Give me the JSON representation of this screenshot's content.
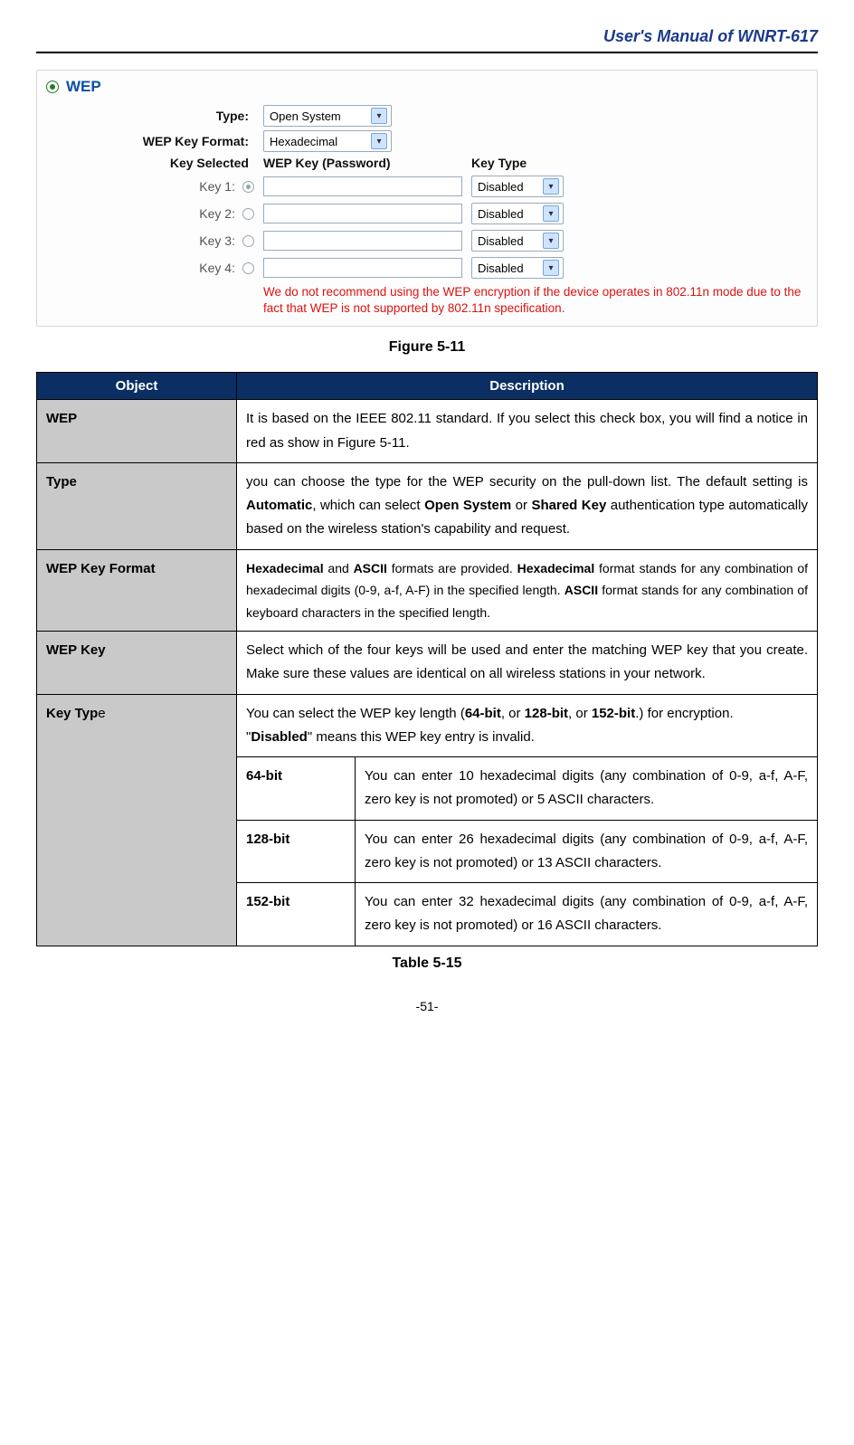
{
  "header": {
    "title": "User's Manual of WNRT-617"
  },
  "panel": {
    "section_title": "WEP",
    "type_label": "Type:",
    "type_value": "Open System",
    "format_label": "WEP Key Format:",
    "format_value": "Hexadecimal",
    "col_key_selected": "Key Selected",
    "col_wep_key": "WEP Key (Password)",
    "col_key_type": "Key Type",
    "keys": [
      {
        "label": "Key 1:",
        "type": "Disabled",
        "selected": true
      },
      {
        "label": "Key 2:",
        "type": "Disabled",
        "selected": false
      },
      {
        "label": "Key 3:",
        "type": "Disabled",
        "selected": false
      },
      {
        "label": "Key 4:",
        "type": "Disabled",
        "selected": false
      }
    ],
    "warning": "We do not recommend using the WEP encryption if the device operates in 802.11n mode due to the fact that WEP is not supported by 802.11n specification."
  },
  "figure_caption": "Figure 5-11",
  "table": {
    "head_object": "Object",
    "head_description": "Description",
    "rows": {
      "wep": {
        "label": "WEP",
        "desc": "It is based on the IEEE 802.11 standard. If you select this check box, you will find a notice in red as show in Figure 5-11."
      },
      "type": {
        "label": "Type",
        "desc_pre": "you can choose the type for the WEP security on the pull-down list. The default setting is ",
        "b1": "Automatic",
        "mid1": ", which can select ",
        "b2": "Open System",
        "mid2": " or ",
        "b3": "Shared Key",
        "tail": " authentication type automatically based on the wireless station's capability and request."
      },
      "format": {
        "label": "WEP Key Format",
        "b1": "Hexadecimal",
        "t1": " and ",
        "b2": "ASCII",
        "t2": " formats are provided.  ",
        "b3": "Hexadecimal",
        "t3": " format stands for any combination of hexadecimal digits (0-9, a-f, A-F) in the specified length. ",
        "b4": "ASCII",
        "t4": " format stands for any combination of keyboard characters in the specified length."
      },
      "wepkey": {
        "label": "WEP Key",
        "desc": "Select which of the four keys will be used and enter the matching WEP key that you create. Make sure these values are identical on all wireless stations in your network."
      },
      "keytype": {
        "label_prefix": "Key Typ",
        "label_suffix": "e",
        "desc_pre": "You can select the WEP key length (",
        "b1": "64-bit",
        "mid1": ", or ",
        "b2": "128-bit",
        "mid2": ", or ",
        "b3": "152-bit",
        "tail1": ".) for encryption.",
        "line2_pre": "\"",
        "b4": "Disabled",
        "line2_post": "\" means this WEP key entry is invalid.",
        "sub": [
          {
            "label": "64-bit",
            "desc": "You can enter 10 hexadecimal digits (any combination of 0-9, a-f, A-F, zero key is not promoted) or 5 ASCII characters."
          },
          {
            "label": "128-bit",
            "desc": "You can enter 26 hexadecimal digits (any combination of 0-9, a-f, A-F, zero key is not promoted) or 13 ASCII characters."
          },
          {
            "label": "152-bit",
            "desc": "You can enter 32 hexadecimal digits (any combination of 0-9, a-f, A-F, zero key is not promoted) or 16 ASCII characters."
          }
        ]
      }
    }
  },
  "table_caption": "Table 5-15",
  "page_number": "-51-"
}
